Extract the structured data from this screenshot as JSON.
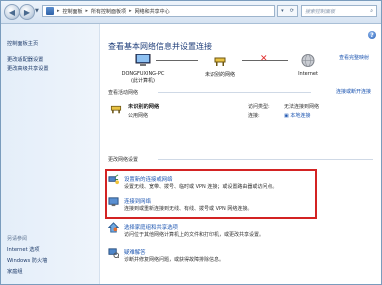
{
  "address_bar": {
    "crumbs": [
      "控制面板",
      "所有控制面板项",
      "网络和共享中心"
    ],
    "search_placeholder": "搜索控制面板"
  },
  "left_nav": {
    "items": [
      "控制面板主页",
      "更改适配器设置",
      "更改高级共享设置"
    ],
    "see_also_title": "另请参阅",
    "see_also": [
      "Internet 选项",
      "Windows 防火墙",
      "家庭组"
    ]
  },
  "main": {
    "title": "查看基本网络信息并设置连接",
    "full_map_link": "查看完整映射",
    "map": {
      "pc_name": "DONGFUXING-PC",
      "pc_sub": "(此计算机)",
      "network": "未识别的网络",
      "internet": "Internet"
    },
    "active_networks": {
      "heading": "查看活动网络",
      "connect_link": "连接或断开连接",
      "name": "未识别的网络",
      "type": "公用网络",
      "access_type_label": "访问类型:",
      "access_type_value": "无法连接到网络",
      "connections_label": "连接:",
      "connections_value": "本地连接"
    },
    "change_settings": {
      "heading": "更改网络设置",
      "tasks": [
        {
          "title": "设置新的连接或网络",
          "desc": "设置无线、宽带、拨号、临时或 VPN 连接；或设置路由器或访问点。"
        },
        {
          "title": "连接到网络",
          "desc": "连接到或重新连接到无线、有线、拨号或 VPN 网络连接。"
        },
        {
          "title": "选择家庭组和共享选项",
          "desc": "访问位于其他网络计算机上的文件和打印机，或更改共享设置。"
        },
        {
          "title": "疑难解答",
          "desc": "诊断并修复网络问题，或获得故障排除信息。"
        }
      ]
    }
  }
}
